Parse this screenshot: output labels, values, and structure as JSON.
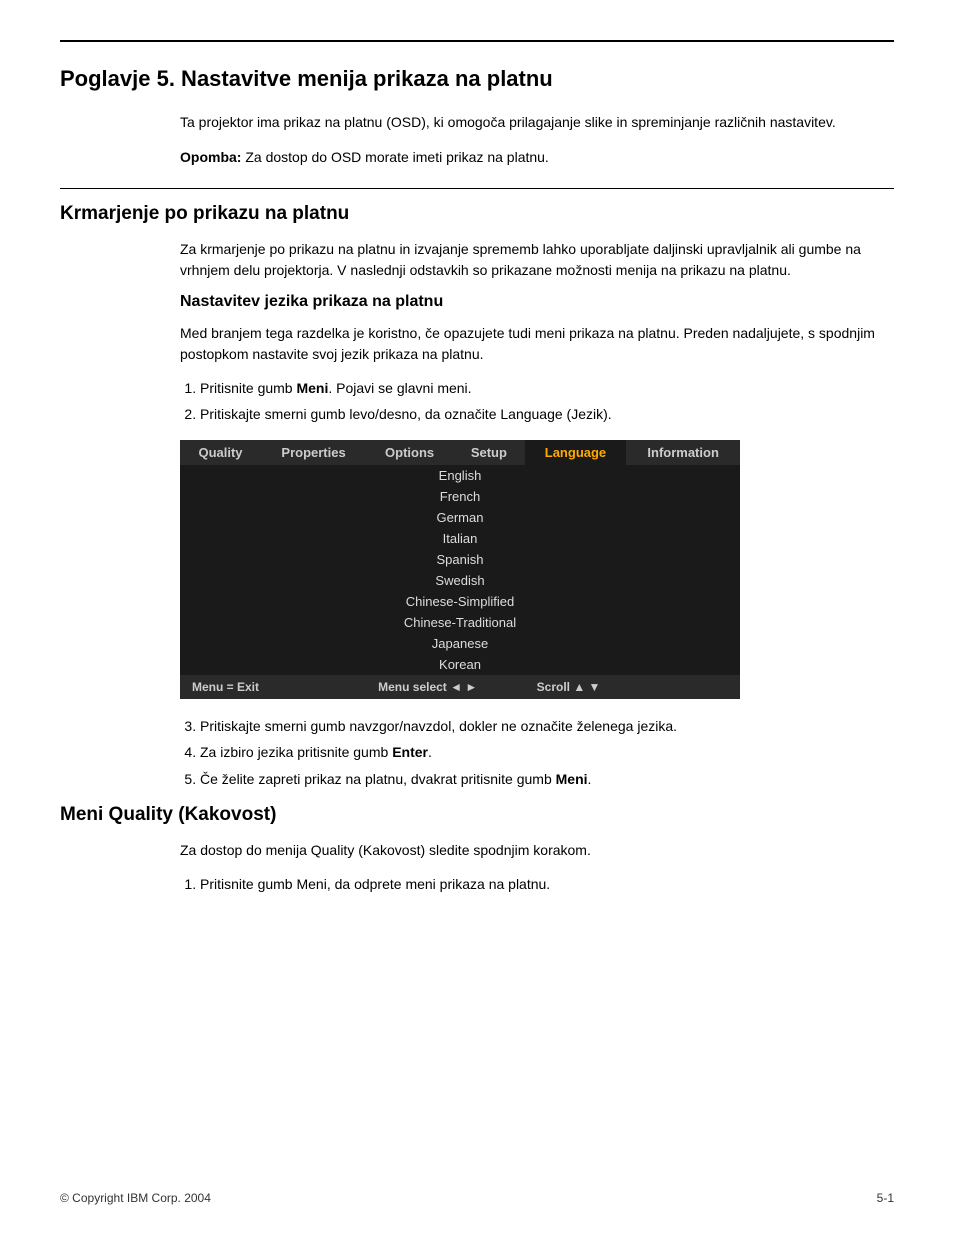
{
  "page": {
    "top_rule": true,
    "chapter_title": "Poglavje 5. Nastavitve menija prikaza na platnu",
    "intro_paragraph": "Ta projektor ima prikaz na platnu (OSD), ki omogoča prilagajanje slike in spreminjanje različnih nastavitev.",
    "note_label": "Opomba:",
    "note_text": " Za dostop do OSD morate imeti prikaz na platnu.",
    "section_rule": true,
    "section_heading": "Krmarjenje po prikazu na platnu",
    "section_body": "Za krmarjenje po prikazu na platnu in izvajanje sprememb lahko uporabljate daljinski upravljalnik ali gumbe na vrhnjem delu projektorja. V naslednji odstavkih so prikazane možnosti menija na prikazu na platnu.",
    "subsection_heading": "Nastavitev jezika prikaza na platnu",
    "subsection_body": "Med branjem tega razdelka je koristno, če opazujete tudi meni prikaza na platnu. Preden nadaljujete, s spodnjim postopkom nastavite svoj jezik prikaza na platnu.",
    "steps_before": [
      "Pritisnite gumb Meni. Pojavi se glavni meni.",
      "Pritiskajte smerni gumb levo/desno, da označite Language (Jezik)."
    ],
    "osd": {
      "header_tabs": [
        "Quality",
        "Properties",
        "Options",
        "Setup",
        "Language",
        "Information"
      ],
      "active_tab": "Language",
      "languages": [
        "English",
        "French",
        "German",
        "Italian",
        "Spanish",
        "Swedish",
        "Chinese-Simplified",
        "Chinese-Traditional",
        "Japanese",
        "Korean"
      ],
      "footer_left": "Menu = Exit",
      "footer_center": "Menu select",
      "footer_right": "Scroll"
    },
    "steps_after": [
      "Pritiskajte smerni gumb navzgor/navzdol, dokler ne označite želenega jezika.",
      "Za izbiro jezika pritisnite gumb Enter.",
      "Če želite zapreti prikaz na platnu, dvakrat pritisnite gumb Meni."
    ],
    "section2_heading": "Meni Quality (Kakovost)",
    "section2_body": "Za dostop do menija Quality (Kakovost) sledite spodnjim korakom.",
    "section2_step1": "Pritisnite gumb Meni, da odprete meni prikaza na platnu.",
    "footer": {
      "copyright": "© Copyright IBM Corp. 2004",
      "page_number": "5-1"
    }
  }
}
